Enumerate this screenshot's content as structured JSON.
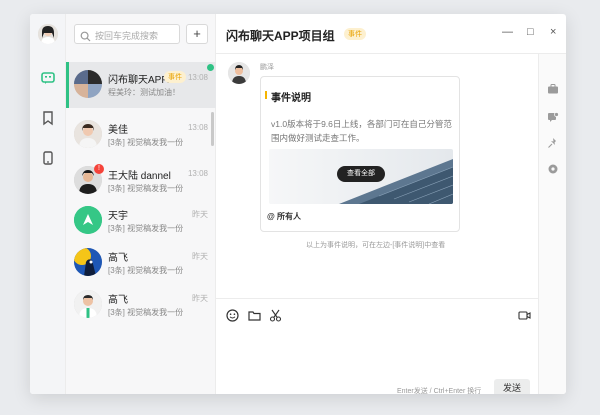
{
  "search": {
    "placeholder": "按回车完成搜索"
  },
  "add_label": "+",
  "conversations": [
    {
      "name": "闪布聊天APP...",
      "tag": "事件",
      "preview": "程美玲：测试加油！",
      "time": "13:08"
    },
    {
      "name": "美佳",
      "preview": "[3条] 视觉稿发我一份",
      "time": "13:08"
    },
    {
      "name": "王大陆 dannel",
      "preview": "[3条] 视觉稿发我一份",
      "time": "13:08",
      "badge": "!"
    },
    {
      "name": "天宇",
      "preview": "[3条] 视觉稿发我一份",
      "time": "昨天"
    },
    {
      "name": "高飞",
      "preview": "[3条] 视觉稿发我一份",
      "time": "昨天"
    },
    {
      "name": "高飞",
      "preview": "[3条] 视觉稿发我一份",
      "time": "昨天"
    }
  ],
  "chat": {
    "title": "闪布聊天APP项目组",
    "title_tag": "事件",
    "window_controls": [
      "—",
      "□",
      "×"
    ],
    "message": {
      "sender": "鹏泽",
      "card_title": "事件说明",
      "card_body": "v1.0版本将于9.6日上线，各部门可在自己分管范围内做好测试走查工作。",
      "view_all": "查看全部",
      "footer": "@ 所有人"
    },
    "system_note": "以上为事件说明，可在左边-[事件说明]中查看",
    "composer": {
      "hint": "Enter发送 / Ctrl+Enter 换行",
      "send_label": "发送"
    }
  },
  "colors": {
    "accent": "#2fc285",
    "tag_bg": "#fdf0cf",
    "tag_fg": "#e8a100",
    "badge": "#f5433a"
  }
}
